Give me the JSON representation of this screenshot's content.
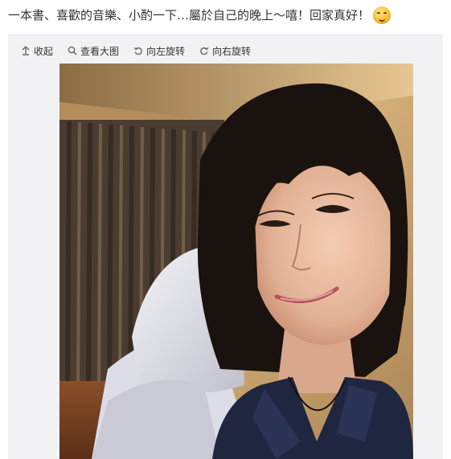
{
  "post": {
    "text": "一本書、喜歡的音樂、小酌一下…屬於自己的晚上～嘻！回家真好！",
    "emoji_icon": "giggle-emoji-icon"
  },
  "toolbar": {
    "items": [
      {
        "label": "收起",
        "icon": "collapse-up-icon"
      },
      {
        "label": "查看大图",
        "icon": "magnifier-icon"
      },
      {
        "label": "向左旋转",
        "icon": "rotate-left-icon"
      },
      {
        "label": "向右旋转",
        "icon": "rotate-right-icon"
      }
    ]
  },
  "photo": {
    "subject": "selfie of smiling woman with bob haircut",
    "colors": {
      "wall": "#c9a36a",
      "curtain": "#5a4a3c",
      "pillow": "#e7e6ee",
      "hair": "#1a120e",
      "skin": "#e9bfa6",
      "shirt": "#1f2640"
    }
  }
}
